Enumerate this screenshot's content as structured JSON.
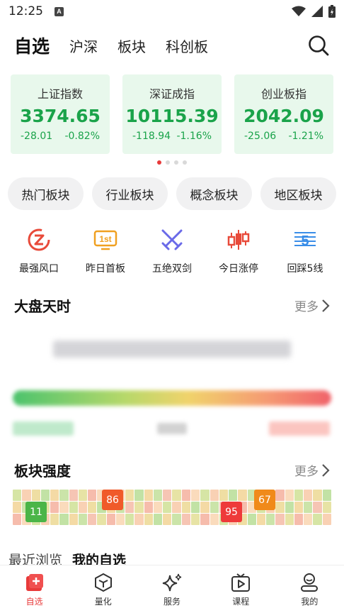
{
  "status_bar": {
    "time": "12:25",
    "badge": "A"
  },
  "nav": {
    "tabs": [
      {
        "label": "自选",
        "active": true
      },
      {
        "label": "沪深",
        "active": false
      },
      {
        "label": "板块",
        "active": false
      },
      {
        "label": "科创板",
        "active": false
      }
    ],
    "search_icon": "search-icon"
  },
  "indices": [
    {
      "name": "上证指数",
      "value": "3374.65",
      "change": "-28.01",
      "pct": "-0.82%"
    },
    {
      "name": "深证成指",
      "value": "10115.39",
      "change": "-118.94",
      "pct": "-1.16%"
    },
    {
      "name": "创业板指",
      "value": "2042.09",
      "change": "-25.06",
      "pct": "-1.21%"
    }
  ],
  "carousel": {
    "count": 4,
    "active": 0
  },
  "sector_pills": [
    "热门板块",
    "行业板块",
    "概念板块",
    "地区板块"
  ],
  "tools": [
    {
      "label": "最强风口",
      "icon": "z-badge-icon"
    },
    {
      "label": "昨日首板",
      "icon": "1st-badge-icon"
    },
    {
      "label": "五绝双剑",
      "icon": "crossed-swords-icon"
    },
    {
      "label": "今日涨停",
      "icon": "candlestick-icon"
    },
    {
      "label": "回踩5线",
      "icon": "five-line-icon"
    }
  ],
  "market": {
    "title": "大盘天时",
    "more": "更多"
  },
  "sector_strength": {
    "title": "板块强度",
    "more": "更多",
    "highlights": [
      "11",
      "86",
      "95",
      "67"
    ]
  },
  "lists": {
    "recent": "最近浏览",
    "mine": "我的自选"
  },
  "tabbar": [
    {
      "label": "自选",
      "icon": "watchlist-icon",
      "active": true
    },
    {
      "label": "量化",
      "icon": "cube-icon",
      "active": false
    },
    {
      "label": "服务",
      "icon": "sparkle-icon",
      "active": false
    },
    {
      "label": "课程",
      "icon": "tv-play-icon",
      "active": false
    },
    {
      "label": "我的",
      "icon": "profile-icon",
      "active": false
    }
  ],
  "colors": {
    "up": "#e83a3a",
    "down": "#1aa34a",
    "card_bg": "#e8f8ec"
  }
}
